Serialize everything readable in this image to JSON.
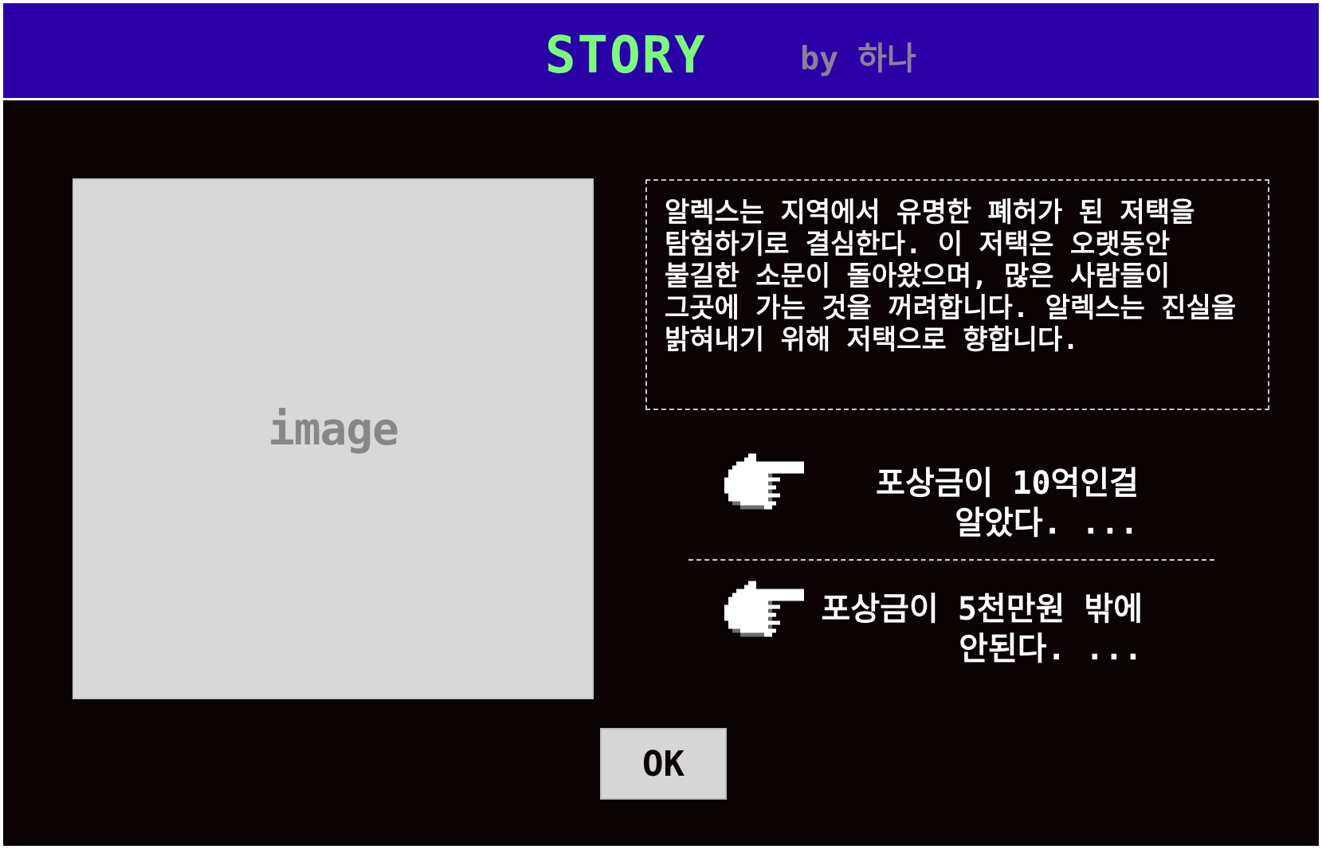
{
  "header": {
    "title": "STORY",
    "byline": "by 하나",
    "title_color": "#7ef97f",
    "background_color": "#2a01a6"
  },
  "image_placeholder": {
    "label": "image"
  },
  "story": {
    "text": "알렉스는 지역에서 유명한 폐허가 된 저택을 탐험하기로 결심한다. 이 저택은 오랫동안 불길한 소문이 돌아왔으며, 많은 사람들이 그곳에 가는 것을 꺼려합니다. 알렉스는 진실을 밝혀내기 위해 저택으로 향합니다."
  },
  "choices": [
    {
      "icon": "pointing-hand-icon",
      "text": "포상금이 10억인걸\n알았다. ..."
    },
    {
      "icon": "pointing-hand-icon",
      "text": "포상금이 5천만원 밖에\n안된다. ..."
    }
  ],
  "ok_button": {
    "label": "OK"
  }
}
